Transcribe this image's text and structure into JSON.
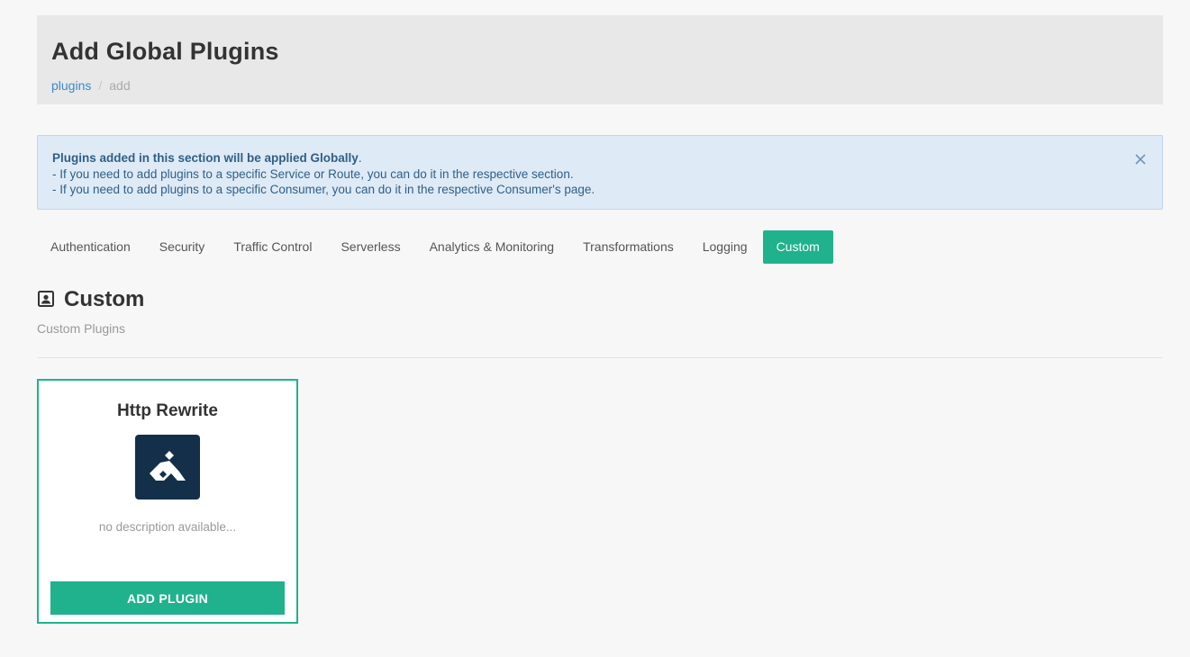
{
  "header": {
    "title": "Add Global Plugins",
    "breadcrumb": {
      "link": "plugins",
      "separator": "/",
      "current": "add"
    }
  },
  "alert": {
    "heading": "Plugins added in this section will be applied Globally",
    "heading_suffix": ".",
    "line1": "- If you need to add plugins to a specific Service or Route, you can do it in the respective section.",
    "line2": "- If you need to add plugins to a specific Consumer, you can do it in the respective Consumer's page.",
    "close_icon": "close-icon"
  },
  "tabs": [
    {
      "label": "Authentication",
      "active": false
    },
    {
      "label": "Security",
      "active": false
    },
    {
      "label": "Traffic Control",
      "active": false
    },
    {
      "label": "Serverless",
      "active": false
    },
    {
      "label": "Analytics & Monitoring",
      "active": false
    },
    {
      "label": "Transformations",
      "active": false
    },
    {
      "label": "Logging",
      "active": false
    },
    {
      "label": "Custom",
      "active": true
    }
  ],
  "section": {
    "icon": "contact-card-icon",
    "title": "Custom",
    "subtitle": "Custom Plugins"
  },
  "plugins": [
    {
      "name": "Http Rewrite",
      "logo_icon": "kong-logo-icon",
      "description": "no description available...",
      "button_label": "ADD PLUGIN"
    }
  ],
  "colors": {
    "accent": "#1fb28c",
    "link": "#3a8ac8",
    "alert_bg": "#deeaf6",
    "logo_bg": "#132f4a"
  }
}
